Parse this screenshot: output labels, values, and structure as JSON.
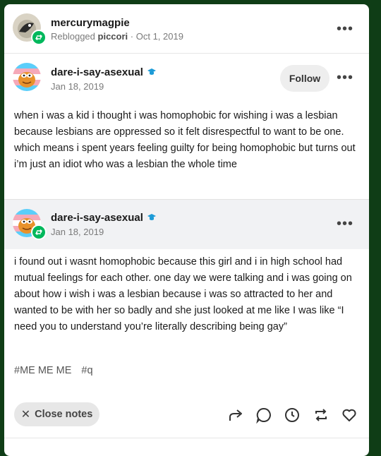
{
  "reblog_header": {
    "username": "mercurymagpie",
    "reblogged_label": "Reblogged",
    "source": "piccori",
    "separator": "·",
    "date": "Oct 1, 2019",
    "avatar_icon": "magpie-avatar-icon",
    "badge_icon": "reblog-icon"
  },
  "original_post": {
    "username": "dare-i-say-asexual",
    "badge_icon": "verified-cap-icon",
    "date": "Jan 18, 2019",
    "follow_label": "Follow",
    "body": "when i was a kid i thought i was homophobic for wishing i was a lesbian because lesbians are oppressed so it felt disrespectful to want to be one. which means i spent years feeling guilty for being homophobic but turns out i’m just an idiot who was a lesbian the whole time"
  },
  "reblog_post": {
    "username": "dare-i-say-asexual",
    "badge_icon": "verified-cap-icon",
    "date": "Jan 18, 2019",
    "body": "i found out i wasnt homophobic because this girl and i in high school had mutual feelings for each other. one day we were talking and i was going on about how i wish i was a lesbian because i was so attracted to her and wanted to be with her so badly and she just looked at me like I was like “I need you to understand you’re literally describing being gay”"
  },
  "tags": [
    "#ME ME ME",
    "#q"
  ],
  "footer": {
    "close_notes_label": "Close notes",
    "icons": [
      "share-icon",
      "reply-icon",
      "history-icon",
      "reblog-icon",
      "like-icon"
    ]
  },
  "colors": {
    "page_background": "#0f3d16",
    "reblog_green": "#00b85c",
    "verified_blue": "#1d9bd7"
  }
}
